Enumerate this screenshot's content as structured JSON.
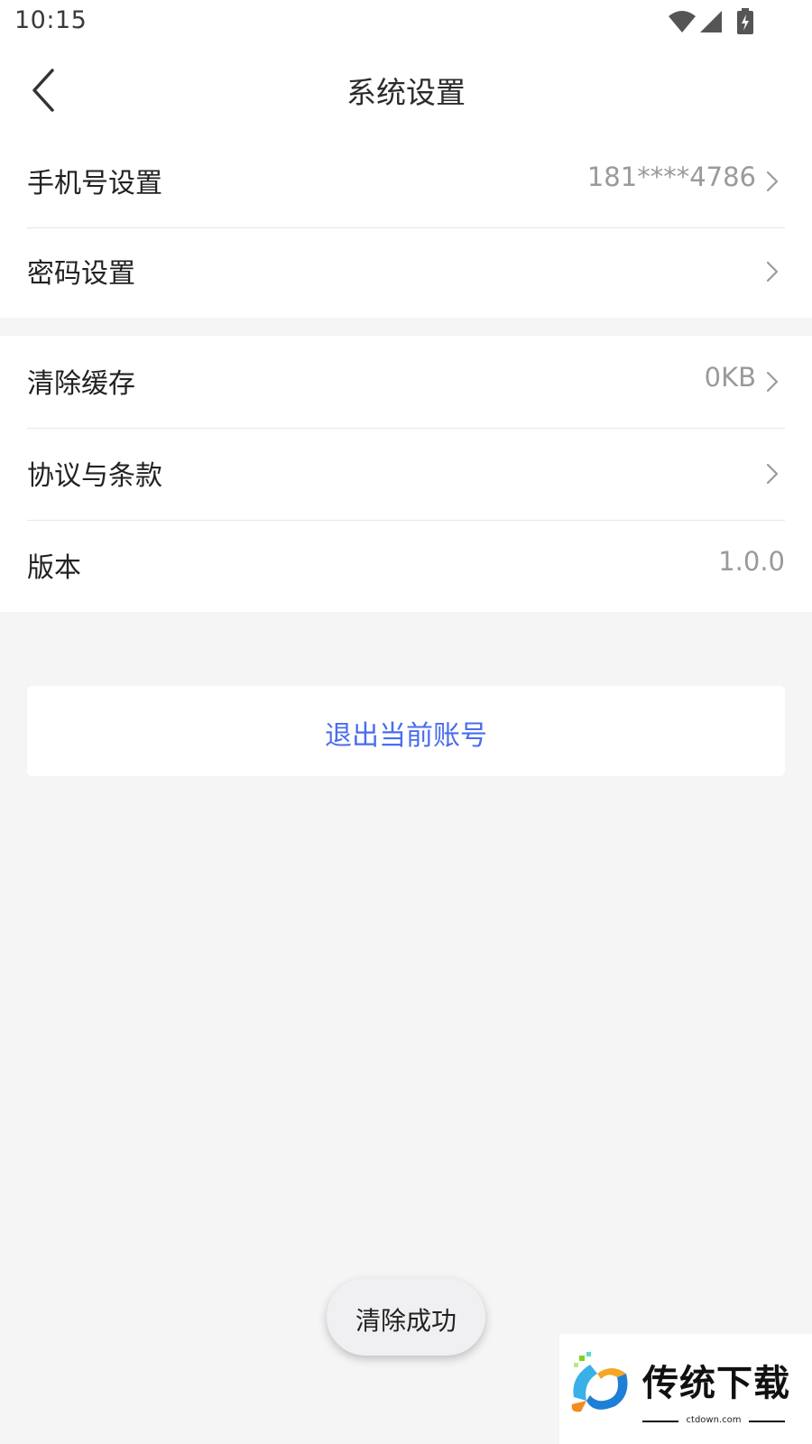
{
  "status_bar": {
    "time": "10:15",
    "icons": [
      "wifi-icon",
      "cellular-signal-icon",
      "battery-charging-icon"
    ]
  },
  "header": {
    "title": "系统设置",
    "back_icon": "chevron-left-icon"
  },
  "settings": {
    "group1": [
      {
        "label": "手机号设置",
        "value": "181****4786",
        "has_arrow": true
      },
      {
        "label": "密码设置",
        "value": "",
        "has_arrow": true
      }
    ],
    "group2": [
      {
        "label": "清除缓存",
        "value": "0KB",
        "has_arrow": true
      },
      {
        "label": "协议与条款",
        "value": "",
        "has_arrow": true
      },
      {
        "label": "版本",
        "value": "1.0.0",
        "has_arrow": false
      }
    ]
  },
  "logout": {
    "label": "退出当前账号"
  },
  "toast": {
    "message": "清除成功"
  },
  "watermark": {
    "text": "传统下载",
    "url": "ctdown.com"
  },
  "colors": {
    "accent": "#4a6cf0",
    "background": "#f5f5f6",
    "secondary_text": "#9a9a9a"
  }
}
